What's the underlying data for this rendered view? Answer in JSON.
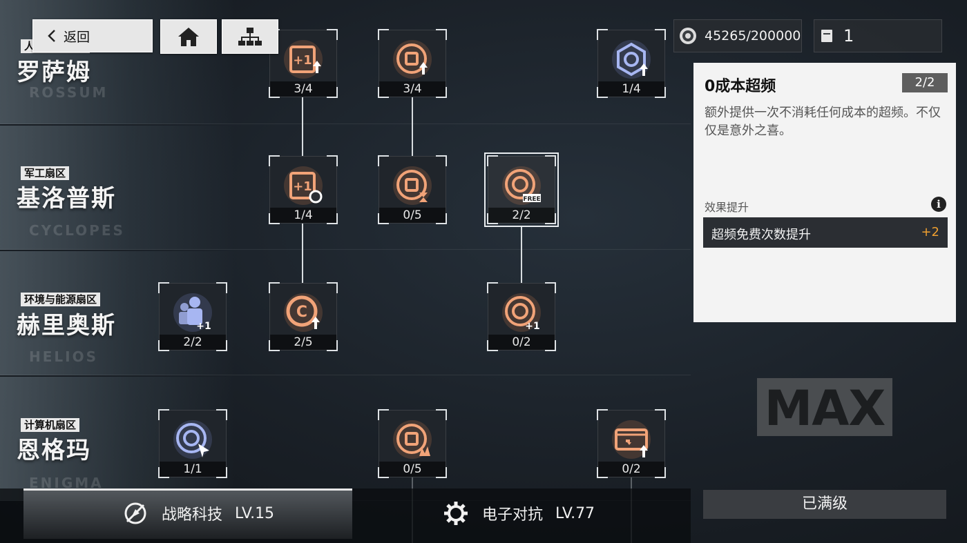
{
  "nav": {
    "back_label": "返回"
  },
  "resources": {
    "currency": "45265/200000",
    "count": "1"
  },
  "regions": [
    {
      "tag": "人工智能扇区",
      "name": "罗萨姆",
      "en": "ROSSUM"
    },
    {
      "tag": "军工扇区",
      "name": "基洛普斯",
      "en": "CYCLOPES"
    },
    {
      "tag": "环境与能源扇区",
      "name": "赫里奥斯",
      "en": "HELIOS"
    },
    {
      "tag": "计算机扇区",
      "name": "恩格玛",
      "en": "ENIGMA"
    }
  ],
  "nodes": [
    {
      "progress": "3/4",
      "icon": "plus-one-upgrade-icon"
    },
    {
      "progress": "3/4",
      "icon": "core-upgrade-icon"
    },
    {
      "progress": "1/4",
      "icon": "shield-upgrade-icon"
    },
    {
      "progress": "1/4",
      "icon": "plus-one-cost-icon"
    },
    {
      "progress": "0/5",
      "icon": "core-timer-icon"
    },
    {
      "progress": "2/2",
      "icon": "free-overclock-icon",
      "badge": "FREE"
    },
    {
      "progress": "2/2",
      "icon": "squad-plus-icon"
    },
    {
      "progress": "2/5",
      "icon": "cost-up-icon"
    },
    {
      "progress": "0/2",
      "icon": "overclock-plus-icon"
    },
    {
      "progress": "1/1",
      "icon": "gauge-cursor-icon"
    },
    {
      "progress": "0/5",
      "icon": "core-burst-icon"
    },
    {
      "progress": "0/2",
      "icon": "card-upgrade-icon"
    }
  ],
  "detail": {
    "title": "0成本超频",
    "level": "2/2",
    "description": "额外提供一次不消耗任何成本的超频。不仅仅是意外之喜。",
    "effect_header": "效果提升",
    "effect_label": "超频免费次数提升",
    "effect_value": "+2",
    "max_label": "MAX",
    "status_button": "已满级"
  },
  "tabs": [
    {
      "label": "战略科技",
      "level": "LV.15"
    },
    {
      "label": "电子对抗",
      "level": "LV.77"
    }
  ],
  "colors": {
    "accent": "#f0a030",
    "icon_orange": "#e88a55",
    "icon_blue": "#8a9dea"
  }
}
